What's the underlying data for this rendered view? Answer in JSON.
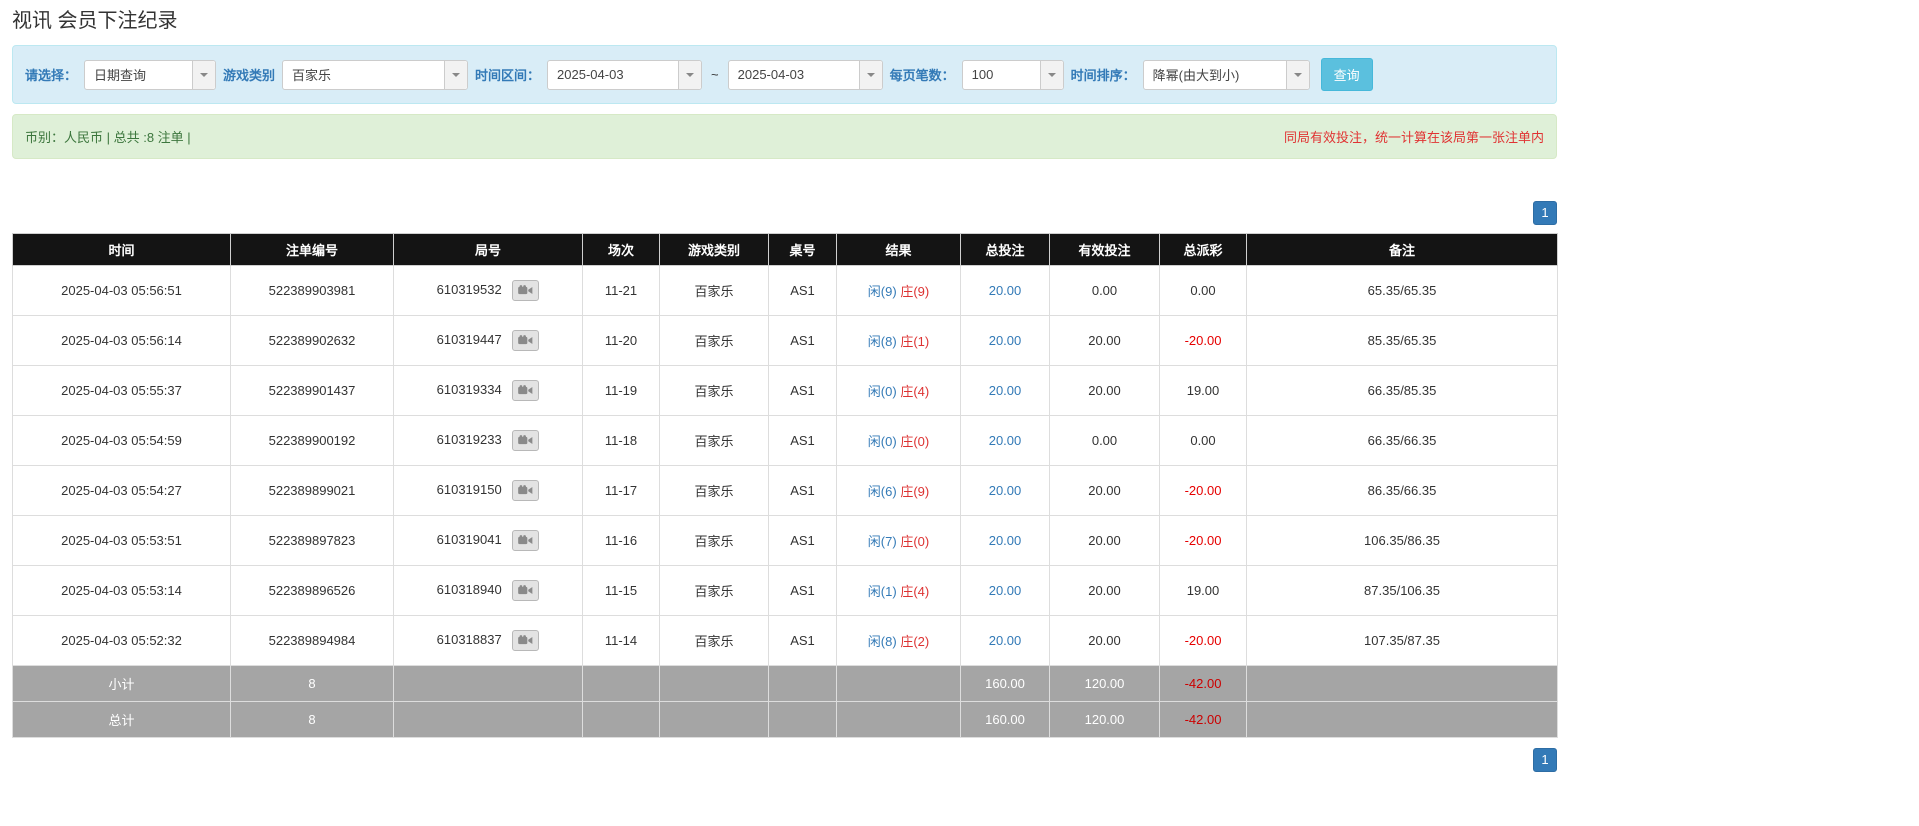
{
  "page": {
    "title": "视讯 会员下注纪录"
  },
  "colors": {
    "accent_blue": "#337ab7",
    "search_button_blue": "#5bc0de",
    "player_blue": "#337ab7",
    "banker_red": "#dd3333",
    "negative_red": "#e60000",
    "notice_red": "#e03333",
    "summary_green": "#3c763d",
    "header_black": "#141414",
    "footer_gray": "#a5a5a5"
  },
  "filters": {
    "select_label": "请选择：",
    "select_value": "日期查询",
    "game_type_label": "游戏类别",
    "game_type_value": "百家乐",
    "date_range_label": "时间区间：",
    "date_from": "2025-04-03",
    "date_separator": "~",
    "date_to": "2025-04-03",
    "page_size_label": "每页笔数：",
    "page_size_value": "100",
    "sort_label": "时间排序：",
    "sort_value": "降幂(由大到小)",
    "search_button": "查询"
  },
  "summary": {
    "left": "币别：人民币 | 总共 :8 注单 |",
    "right": "同局有效投注，统一计算在该局第一张注单内"
  },
  "pagination": {
    "page": "1"
  },
  "icons": {
    "dropdown": "chevron-down-icon",
    "round_video": "video-camera-icon"
  },
  "table": {
    "headers": [
      "时间",
      "注单编号",
      "局号",
      "场次",
      "游戏类别",
      "桌号",
      "结果",
      "总投注",
      "有效投注",
      "总派彩",
      "备注"
    ],
    "rows": [
      {
        "time": "2025-04-03 05:56:51",
        "bet_id": "522389903981",
        "round_id": "610319532",
        "session": "11-21",
        "game": "百家乐",
        "table_no": "AS1",
        "result_player": "闲(9)",
        "result_banker": "庄(9)",
        "total_bet": "20.00",
        "valid_bet": "0.00",
        "payout": "0.00",
        "note": "65.35/65.35"
      },
      {
        "time": "2025-04-03 05:56:14",
        "bet_id": "522389902632",
        "round_id": "610319447",
        "session": "11-20",
        "game": "百家乐",
        "table_no": "AS1",
        "result_player": "闲(8)",
        "result_banker": "庄(1)",
        "total_bet": "20.00",
        "valid_bet": "20.00",
        "payout": "-20.00",
        "note": "85.35/65.35"
      },
      {
        "time": "2025-04-03 05:55:37",
        "bet_id": "522389901437",
        "round_id": "610319334",
        "session": "11-19",
        "game": "百家乐",
        "table_no": "AS1",
        "result_player": "闲(0)",
        "result_banker": "庄(4)",
        "total_bet": "20.00",
        "valid_bet": "20.00",
        "payout": "19.00",
        "note": "66.35/85.35"
      },
      {
        "time": "2025-04-03 05:54:59",
        "bet_id": "522389900192",
        "round_id": "610319233",
        "session": "11-18",
        "game": "百家乐",
        "table_no": "AS1",
        "result_player": "闲(0)",
        "result_banker": "庄(0)",
        "total_bet": "20.00",
        "valid_bet": "0.00",
        "payout": "0.00",
        "note": "66.35/66.35"
      },
      {
        "time": "2025-04-03 05:54:27",
        "bet_id": "522389899021",
        "round_id": "610319150",
        "session": "11-17",
        "game": "百家乐",
        "table_no": "AS1",
        "result_player": "闲(6)",
        "result_banker": "庄(9)",
        "total_bet": "20.00",
        "valid_bet": "20.00",
        "payout": "-20.00",
        "note": "86.35/66.35"
      },
      {
        "time": "2025-04-03 05:53:51",
        "bet_id": "522389897823",
        "round_id": "610319041",
        "session": "11-16",
        "game": "百家乐",
        "table_no": "AS1",
        "result_player": "闲(7)",
        "result_banker": "庄(0)",
        "total_bet": "20.00",
        "valid_bet": "20.00",
        "payout": "-20.00",
        "note": "106.35/86.35"
      },
      {
        "time": "2025-04-03 05:53:14",
        "bet_id": "522389896526",
        "round_id": "610318940",
        "session": "11-15",
        "game": "百家乐",
        "table_no": "AS1",
        "result_player": "闲(1)",
        "result_banker": "庄(4)",
        "total_bet": "20.00",
        "valid_bet": "20.00",
        "payout": "19.00",
        "note": "87.35/106.35"
      },
      {
        "time": "2025-04-03 05:52:32",
        "bet_id": "522389894984",
        "round_id": "610318837",
        "session": "11-14",
        "game": "百家乐",
        "table_no": "AS1",
        "result_player": "闲(8)",
        "result_banker": "庄(2)",
        "total_bet": "20.00",
        "valid_bet": "20.00",
        "payout": "-20.00",
        "note": "107.35/87.35"
      }
    ],
    "subtotal": {
      "label": "小计",
      "count": "8",
      "total_bet": "160.00",
      "valid_bet": "120.00",
      "payout": "-42.00"
    },
    "total": {
      "label": "总计",
      "count": "8",
      "total_bet": "160.00",
      "valid_bet": "120.00",
      "payout": "-42.00"
    }
  }
}
